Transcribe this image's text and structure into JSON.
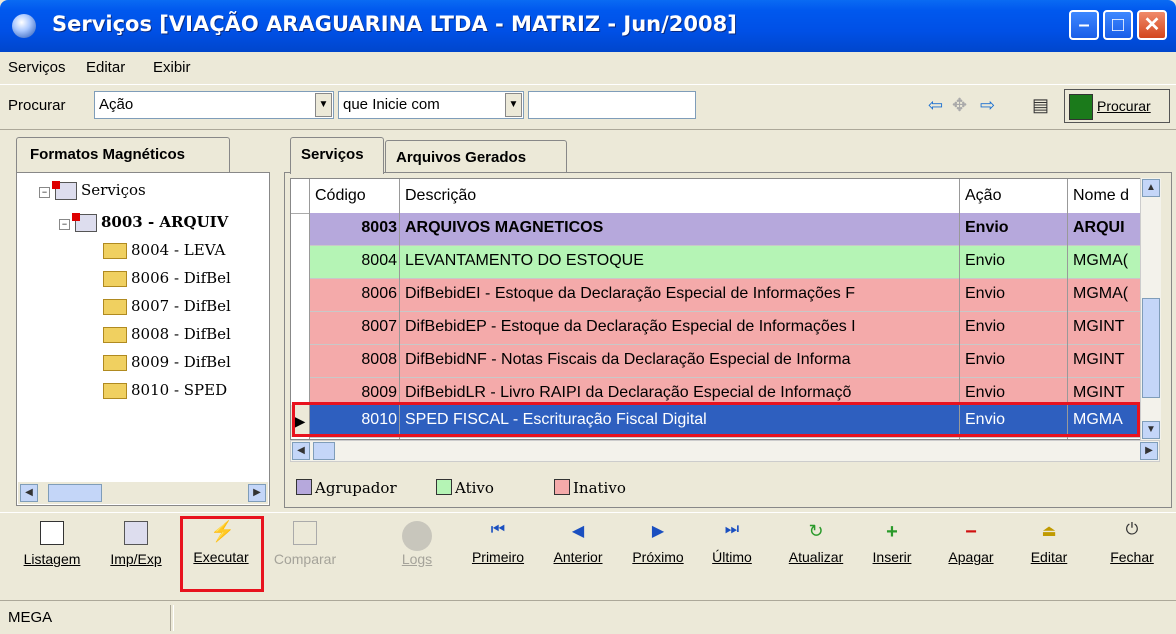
{
  "window": {
    "title": "Serviços [VIAÇÃO ARAGUARINA LTDA - MATRIZ - Jun/2008]"
  },
  "menu": [
    "Serviços",
    "Editar",
    "Exibir"
  ],
  "search": {
    "label": "Procurar",
    "field": "Ação",
    "operator": "que Inicie com",
    "value": "",
    "button": "Procurar"
  },
  "left_panel": {
    "tab": "Formatos Magnéticos",
    "root": "Serviços",
    "group": "8003 - ARQUIV",
    "items": [
      "8004 - LEVA",
      "8006 - DifBel",
      "8007 - DifBel",
      "8008 - DifBel",
      "8009 - DifBel",
      "8010 - SPED"
    ]
  },
  "right_tabs": [
    "Serviços",
    "Arquivos Gerados"
  ],
  "grid": {
    "columns": [
      "Código",
      "Descrição",
      "Ação",
      "Nome d"
    ],
    "rows": [
      {
        "codigo": "8003",
        "descricao": "ARQUIVOS MAGNETICOS",
        "acao": "Envio",
        "nome": "ARQUI",
        "type": "agrupador"
      },
      {
        "codigo": "8004",
        "descricao": "LEVANTAMENTO DO ESTOQUE",
        "acao": "Envio",
        "nome": "MGMA(",
        "type": "ativo"
      },
      {
        "codigo": "8006",
        "descricao": "DifBebidEI - Estoque da Declaração Especial de Informações F",
        "acao": "Envio",
        "nome": "MGMA(",
        "type": "inativo"
      },
      {
        "codigo": "8007",
        "descricao": "DifBebidEP - Estoque da Declaração Especial de Informações I",
        "acao": "Envio",
        "nome": "MGINT",
        "type": "inativo"
      },
      {
        "codigo": "8008",
        "descricao": "DifBebidNF - Notas Fiscais da Declaração Especial de Informa",
        "acao": "Envio",
        "nome": "MGINT",
        "type": "inativo"
      },
      {
        "codigo": "8009",
        "descricao": "DifBebidLR - Livro RAIPI da Declaração Especial de Informaçõ",
        "acao": "Envio",
        "nome": "MGINT",
        "type": "inativo"
      },
      {
        "codigo": "8010",
        "descricao": "SPED FISCAL - Escrituração Fiscal Digital",
        "acao": "Envio",
        "nome": "MGMA",
        "type": "selected"
      }
    ]
  },
  "legend": [
    {
      "label": "Agrupador",
      "color": "#b6a8dc"
    },
    {
      "label": "Ativo",
      "color": "#b5f4b5"
    },
    {
      "label": "Inativo",
      "color": "#f4aaaa"
    }
  ],
  "toolbar": [
    {
      "label": "Listagem",
      "icon": "report-icon"
    },
    {
      "label": "Imp/Exp",
      "icon": "import-export-icon"
    },
    {
      "label": "Executar",
      "icon": "lightning-icon"
    },
    {
      "label": "Comparar",
      "icon": "compare-icon"
    },
    {
      "label": "Logs",
      "icon": "magnifier-icon"
    },
    {
      "label": "Primeiro",
      "icon": "first-icon"
    },
    {
      "label": "Anterior",
      "icon": "previous-icon"
    },
    {
      "label": "Próximo",
      "icon": "next-icon"
    },
    {
      "label": "Último",
      "icon": "last-icon"
    },
    {
      "label": "Atualizar",
      "icon": "refresh-icon"
    },
    {
      "label": "Inserir",
      "icon": "plus-icon"
    },
    {
      "label": "Apagar",
      "icon": "minus-icon"
    },
    {
      "label": "Editar",
      "icon": "edit-icon"
    },
    {
      "label": "Fechar",
      "icon": "exit-icon"
    }
  ],
  "status": {
    "text": "MEGA"
  },
  "colors": {
    "title_bar": "#0058ee",
    "selection": "#2e5fbf",
    "highlight": "#e8121e"
  }
}
